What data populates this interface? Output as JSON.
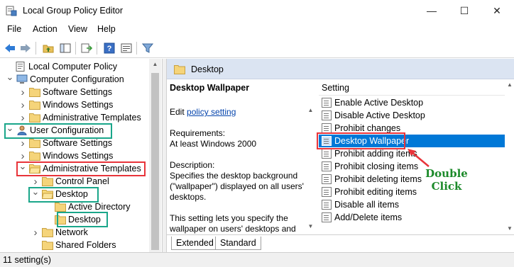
{
  "window": {
    "title": "Local Group Policy Editor",
    "minimize": "—",
    "maximize": "☐",
    "close": "✕"
  },
  "menu": [
    "File",
    "Action",
    "View",
    "Help"
  ],
  "tree": [
    {
      "label": "Local Computer Policy",
      "indent": 0,
      "chevron": "",
      "icon": "policy-icon"
    },
    {
      "label": "Computer Configuration",
      "indent": 1,
      "chevron": "v",
      "icon": "computer-icon"
    },
    {
      "label": "Software Settings",
      "indent": 2,
      "chevron": ">",
      "icon": "folder-icon"
    },
    {
      "label": "Windows Settings",
      "indent": 2,
      "chevron": ">",
      "icon": "folder-icon"
    },
    {
      "label": "Administrative Templates",
      "indent": 2,
      "chevron": ">",
      "icon": "folder-icon"
    },
    {
      "label": "User Configuration",
      "indent": 1,
      "chevron": "v",
      "icon": "user-icon"
    },
    {
      "label": "Software Settings",
      "indent": 2,
      "chevron": ">",
      "icon": "folder-icon"
    },
    {
      "label": "Windows Settings",
      "indent": 2,
      "chevron": ">",
      "icon": "folder-icon"
    },
    {
      "label": "Administrative Templates",
      "indent": 2,
      "chevron": "v",
      "icon": "folder-open-icon"
    },
    {
      "label": "Control Panel",
      "indent": 3,
      "chevron": ">",
      "icon": "folder-icon"
    },
    {
      "label": "Desktop",
      "indent": 3,
      "chevron": "v",
      "icon": "folder-open-icon"
    },
    {
      "label": "Active Directory",
      "indent": 4,
      "chevron": "",
      "icon": "folder-icon"
    },
    {
      "label": "Desktop",
      "indent": 4,
      "chevron": "",
      "icon": "folder-icon"
    },
    {
      "label": "Network",
      "indent": 3,
      "chevron": ">",
      "icon": "folder-icon"
    },
    {
      "label": "Shared Folders",
      "indent": 3,
      "chevron": "",
      "icon": "folder-icon"
    }
  ],
  "right_header": "Desktop",
  "description": {
    "title": "Desktop Wallpaper",
    "edit_prefix": "Edit",
    "edit_link": "policy setting",
    "requirements_label": "Requirements:",
    "requirements_value": "At least Windows 2000",
    "description_label": "Description:",
    "description_text": "Specifies the desktop background (\"wallpaper\") displayed on all users' desktops.",
    "more_text": "This setting lets you specify the wallpaper on users' desktops and"
  },
  "settings_header": "Setting",
  "settings": [
    "Enable Active Desktop",
    "Disable Active Desktop",
    "Prohibit changes",
    "Desktop Wallpaper",
    "Prohibit adding items",
    "Prohibit closing items",
    "Prohibit deleting items",
    "Prohibit editing items",
    "Disable all items",
    "Add/Delete items"
  ],
  "selected_setting": "Desktop Wallpaper",
  "tabs": [
    "Extended",
    "Standard"
  ],
  "status": "11 setting(s)",
  "callout": {
    "line1": "Double",
    "line2": "Click"
  },
  "colors": {
    "selection": "#0078d7",
    "header_bg": "#dbe4f2",
    "annotation_green": "#1aa68a",
    "annotation_red": "#e8343a",
    "callout_text": "#1c8a2a"
  }
}
